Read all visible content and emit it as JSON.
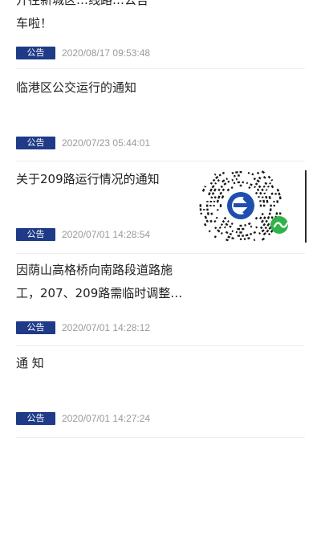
{
  "items": [
    {
      "title": "开往新城区…线路…公告\n车啦！",
      "badge": "公告",
      "date": "2020/08/17 09:53:48"
    },
    {
      "title": "临港区公交运行的通知",
      "badge": "公告",
      "date": "2020/07/23 05:44:01"
    },
    {
      "title": "关于209路运行情况的通知",
      "badge": "公告",
      "date": "2020/07/01 14:28:54"
    },
    {
      "title": "因荫山高格桥向南路段道路施\n工，207、209路需临时调整…",
      "badge": "公告",
      "date": "2020/07/01 14:28:12"
    },
    {
      "title": "通 知",
      "badge": "公告",
      "date": "2020/07/01 14:27:24"
    }
  ],
  "overlay": {
    "icon": "mini-program-qr-code-icon"
  },
  "colors": {
    "badge_bg": "#1f3a87",
    "date_text": "#9a9a9a",
    "divider": "#eeeeee"
  }
}
